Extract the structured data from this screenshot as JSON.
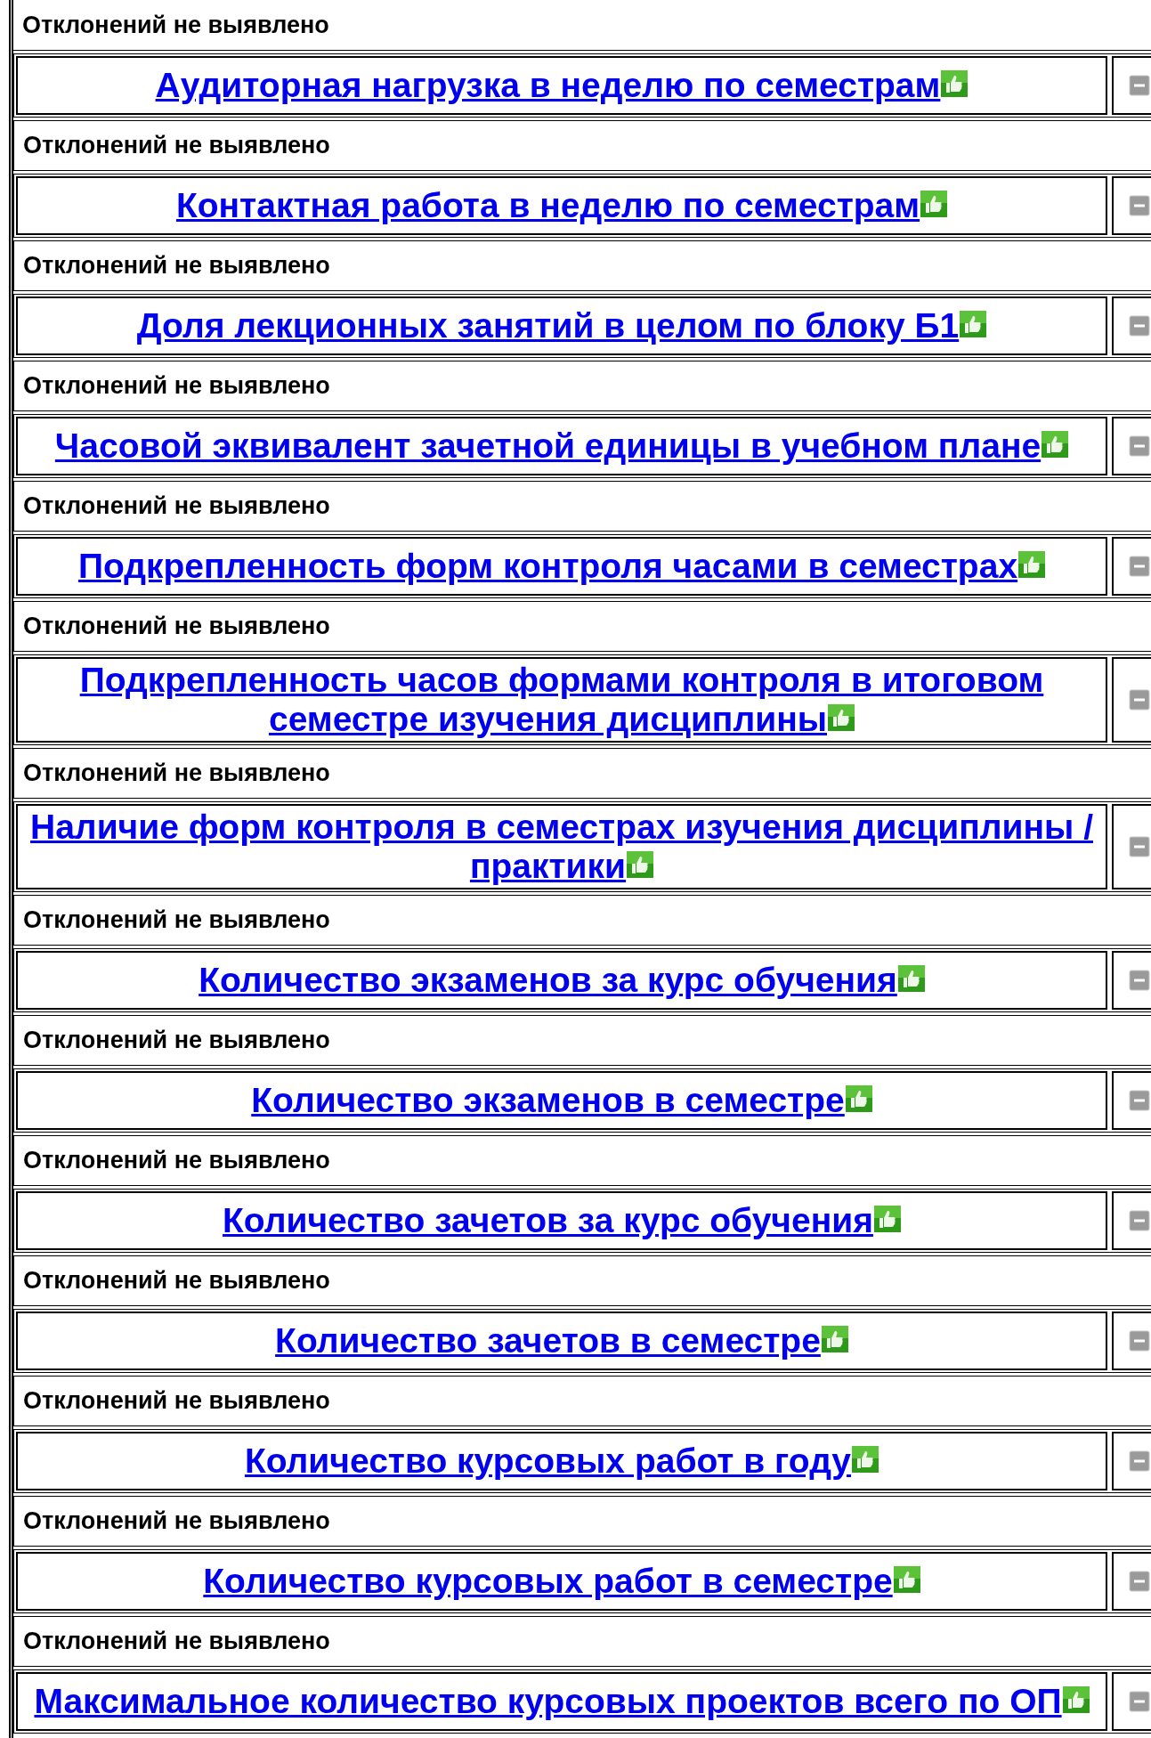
{
  "top_result": "Отклонений не выявлено",
  "criteria": [
    {
      "title": "Аудиторная нагрузка в неделю по семестрам",
      "result": "Отклонений не выявлено"
    },
    {
      "title": "Контактная работа в неделю по семестрам",
      "result": "Отклонений не выявлено"
    },
    {
      "title": "Доля лекционных занятий в целом по блоку Б1",
      "result": "Отклонений не выявлено"
    },
    {
      "title": "Часовой эквивалент зачетной единицы в учебном плане",
      "result": "Отклонений не выявлено"
    },
    {
      "title": "Подкрепленность форм контроля часами в семестрах",
      "result": "Отклонений не выявлено"
    },
    {
      "title": "Подкрепленность часов формами контроля в итоговом семестре изучения дисциплины",
      "result": "Отклонений не выявлено"
    },
    {
      "title": "Наличие форм контроля в семестрах изучения дисциплины / практики",
      "result": "Отклонений не выявлено"
    },
    {
      "title": "Количество экзаменов за курс обучения",
      "result": "Отклонений не выявлено"
    },
    {
      "title": "Количество экзаменов в семестре",
      "result": "Отклонений не выявлено"
    },
    {
      "title": "Количество зачетов за курс обучения",
      "result": "Отклонений не выявлено"
    },
    {
      "title": "Количество зачетов в семестре",
      "result": "Отклонений не выявлено"
    },
    {
      "title": "Количество курсовых работ в году",
      "result": "Отклонений не выявлено"
    },
    {
      "title": "Количество курсовых работ в семестре",
      "result": "Отклонений не выявлено"
    },
    {
      "title": "Максимальное количество курсовых проектов всего по ОП"
    }
  ]
}
